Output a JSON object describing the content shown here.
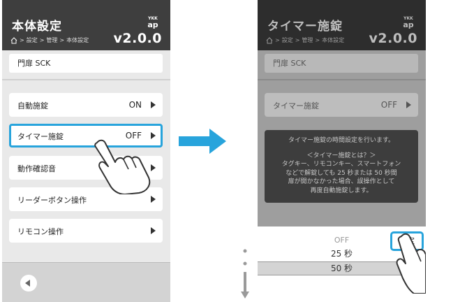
{
  "colors": {
    "accent": "#28a4dc",
    "header_bg": "#3e3e3e",
    "panel_bg": "#e9e9e9"
  },
  "left": {
    "header": {
      "title": "本体設定",
      "breadcrumb": [
        "設定",
        "管理",
        "本体設定"
      ],
      "version": "v2.0.0",
      "logo_top": "YKK",
      "logo_bottom": "ap"
    },
    "device_name": "門扉 SCK",
    "menu": [
      {
        "label": "自動施錠",
        "value": "ON"
      },
      {
        "label": "タイマー施錠",
        "value": "OFF"
      },
      {
        "label": "動作確認音",
        "value": ""
      },
      {
        "label": "リーダーボタン操作",
        "value": ""
      },
      {
        "label": "リモコン操作",
        "value": ""
      }
    ]
  },
  "right": {
    "header": {
      "title": "タイマー施錠",
      "breadcrumb": [
        "設定",
        "管理",
        "本体設定"
      ],
      "version": "v2.0.0",
      "logo_top": "YKK",
      "logo_bottom": "ap"
    },
    "device_name": "門扉 SCK",
    "item": {
      "label": "タイマー施錠",
      "value": "OFF"
    },
    "info": {
      "line1": "タイマー施錠の時間設定を行います。",
      "line2": "＜タイマー施錠とは？＞",
      "line3": "タグキー、リモコンキー、スマートフォン",
      "line4": "などで解錠しても 25 秒または 50 秒間",
      "line5": "扉が開かなかった場合、誤操作として",
      "line6": "再度自動施錠します。"
    },
    "picker": {
      "options": [
        "OFF",
        "25 秒",
        "50 秒"
      ],
      "confirm": "決定"
    }
  }
}
